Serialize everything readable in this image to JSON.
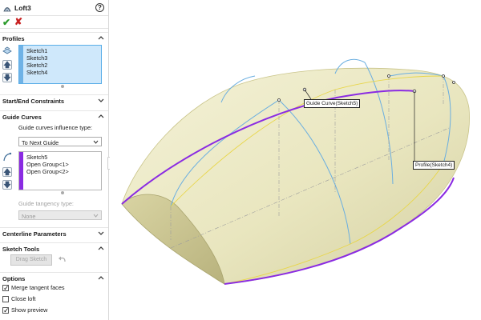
{
  "feature": {
    "title": "Loft3",
    "help_icon": "question-circle-icon",
    "ok_icon": "checkmark-icon",
    "cancel_icon": "x-icon"
  },
  "profiles": {
    "header": "Profiles",
    "items": [
      "Sketch1",
      "Sketch3",
      "Sketch2",
      "Sketch4"
    ],
    "strip_color": "#6fb2e6"
  },
  "start_end_constraints": {
    "header": "Start/End Constraints"
  },
  "guide_curves": {
    "header": "Guide Curves",
    "influence_label": "Guide curves influence type:",
    "influence_value": "To Next Guide",
    "items": [
      "Sketch5",
      "Open Group<1>",
      "Open Group<2>"
    ],
    "strip_color": "#8a2be2",
    "tangency_label": "Guide tangency type:",
    "tangency_value": "None"
  },
  "centerline_parameters": {
    "header": "Centerline Parameters"
  },
  "sketch_tools": {
    "header": "Sketch Tools",
    "drag_sketch_label": "Drag Sketch"
  },
  "options": {
    "header": "Options",
    "merge_tangent_faces": {
      "label": "Merge tangent faces",
      "checked": true
    },
    "close_loft": {
      "label": "Close loft",
      "checked": false
    },
    "show_preview": {
      "label": "Show preview",
      "checked": true
    }
  },
  "viewport": {
    "callout_guide": "Guide Curve(Sketch5)",
    "callout_profile": "Profile(Sketch4)",
    "surface_color": "#ecebc6",
    "guide_color": "#8a2be2",
    "profile_color": "#6aaee0",
    "highlight_color": "#e8d64a"
  }
}
